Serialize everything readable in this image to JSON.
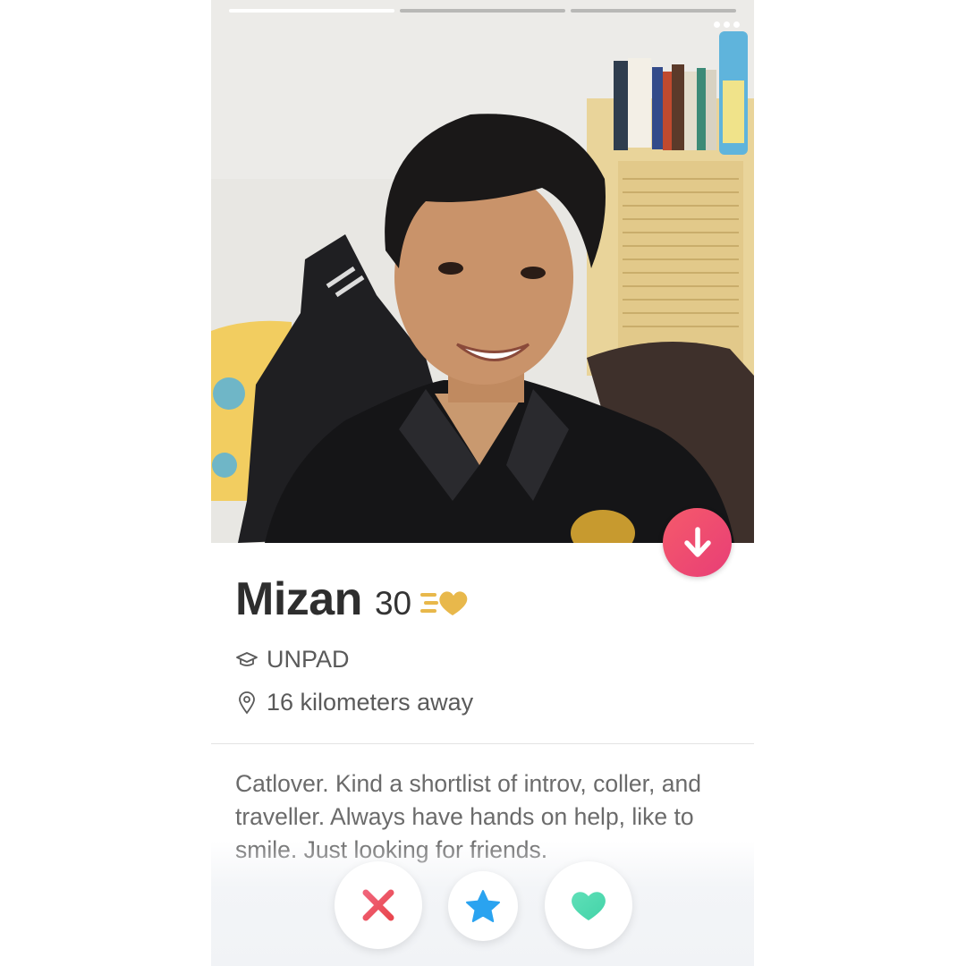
{
  "profile": {
    "name": "Mizan",
    "age": "30",
    "school": "UNPAD",
    "distance": "16 kilometers away",
    "bio": "Catlover. Kind a shortlist of introv, coller, and traveller. Always have hands on help, like to smile. Just looking for friends."
  },
  "photo": {
    "page_count": 3,
    "active_index": 0,
    "description_icon": "profile-photo"
  },
  "icons": {
    "collapse": "arrow-down-icon",
    "superlike_badge": "superlike-heart-icon",
    "school": "graduation-cap-icon",
    "distance": "location-pin-icon",
    "nope": "close-icon",
    "super_like": "star-icon",
    "like": "heart-icon"
  },
  "colors": {
    "accent_pink": "#ee4b6f",
    "nope_red": "#f2566a",
    "super_blue": "#2aa3f0",
    "like_green": "#52dcb0",
    "gold": "#e8b84b"
  }
}
